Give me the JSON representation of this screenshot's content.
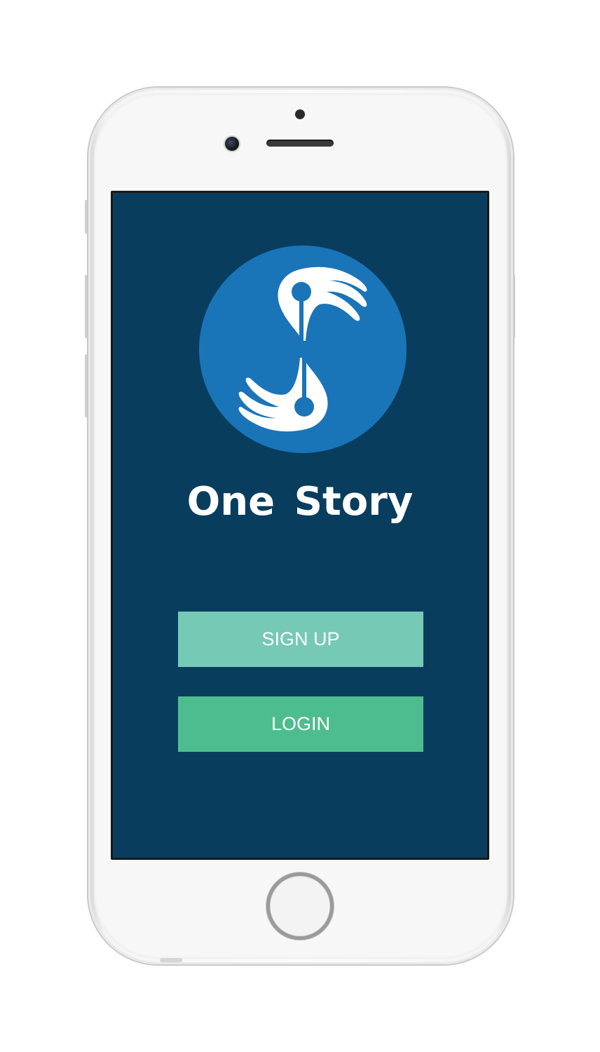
{
  "app": {
    "title": "One Story"
  },
  "buttons": {
    "signup_label": "SIGN UP",
    "login_label": "LOGIN"
  },
  "icons": {
    "logo": "one-story-logo-icon",
    "home": "home-button-icon"
  },
  "colors": {
    "screen_background": "#083d5e",
    "logo_circle": "#1a74b8",
    "signup_button": "#76c9b5",
    "login_button": "#4dbd8f",
    "text": "#ffffff"
  }
}
